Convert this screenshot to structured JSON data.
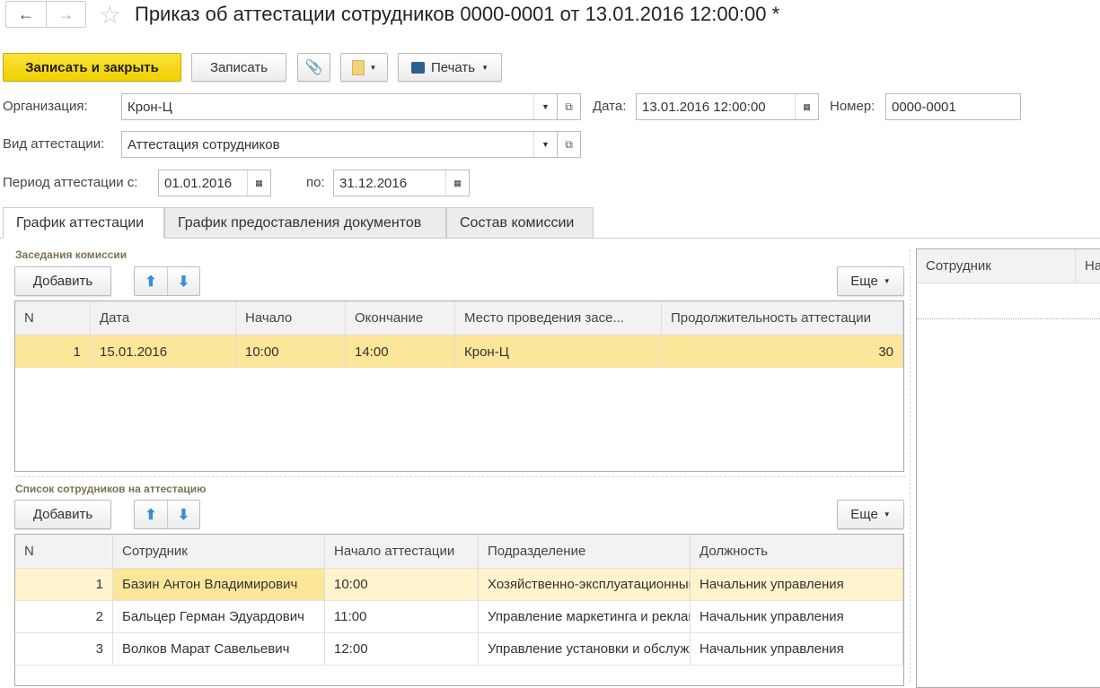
{
  "header": {
    "title": "Приказ об аттестации сотрудников 0000-0001 от 13.01.2016 12:00:00 *",
    "back": "←",
    "forward": "→",
    "star": "☆"
  },
  "toolbar": {
    "save_close": "Записать и закрыть",
    "save": "Записать",
    "print": "Печать"
  },
  "form": {
    "org_label": "Организация:",
    "org_value": "Крон-Ц",
    "date_label": "Дата:",
    "date_value": "13.01.2016 12:00:00",
    "number_label": "Номер:",
    "number_value": "0000-0001",
    "kind_label": "Вид аттестации:",
    "kind_value": "Аттестация сотрудников",
    "period_label": "Период аттестации с:",
    "period_from": "01.01.2016",
    "period_to_label": "по:",
    "period_to": "31.12.2016"
  },
  "tabs": [
    {
      "label": "График аттестации",
      "active": true
    },
    {
      "label": "График предоставления документов"
    },
    {
      "label": "Состав комиссии"
    }
  ],
  "meetings": {
    "title": "Заседания комиссии",
    "add": "Добавить",
    "more": "Еще",
    "columns": [
      "N",
      "Дата",
      "Начало",
      "Окончание",
      "Место проведения засе...",
      "Продолжительность аттестации"
    ],
    "rows": [
      [
        "1",
        "15.01.2016",
        "10:00",
        "14:00",
        "Крон-Ц",
        "30"
      ]
    ]
  },
  "employees": {
    "title": "Список сотрудников на аттестацию",
    "add": "Добавить",
    "more": "Еще",
    "columns": [
      "N",
      "Сотрудник",
      "Начало аттестации",
      "Подразделение",
      "Должность"
    ],
    "rows": [
      [
        "1",
        "Базин Антон Владимирович",
        "10:00",
        "Хозяйственно-эксплуатационный отдел",
        "Начальник управления"
      ],
      [
        "2",
        "Бальцер Герман Эдуардович",
        "11:00",
        "Управление маркетинга и рекламы",
        "Начальник управления"
      ],
      [
        "3",
        "Волков Марат Савельевич",
        "12:00",
        "Управление установки и обслуживания",
        "Начальник управления"
      ]
    ]
  },
  "right_panel": {
    "columns": [
      "Сотрудник",
      "На"
    ]
  },
  "colors": {
    "accent": "#f5d800",
    "selected_row": "#fbe69a"
  }
}
